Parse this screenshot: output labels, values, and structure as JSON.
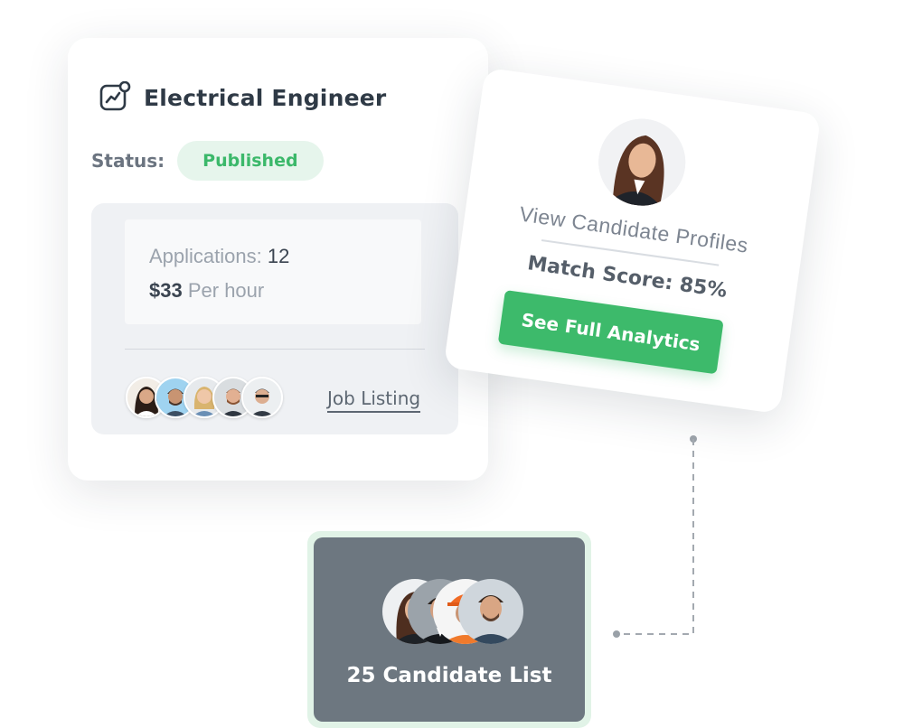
{
  "job_card": {
    "title": "Electrical Engineer",
    "icon": "chart-trend-icon",
    "status_label": "Status:",
    "status_value": "Published",
    "applications_label": "Applications:",
    "applications_count": "12",
    "rate_amount": "$33",
    "rate_unit": "Per hour",
    "link_label": "Job Listing"
  },
  "profile_card": {
    "view_label": "View Candidate Profiles",
    "match_score": "Match Score: 85%",
    "button_label": "See Full Analytics"
  },
  "candidate_list": {
    "label": "25 Candidate List"
  },
  "colors": {
    "accent_green": "#3dba6b",
    "badge_bg": "#e6f5ec",
    "list_card_bg": "#6d7780",
    "text_dark": "#2f3a46"
  }
}
